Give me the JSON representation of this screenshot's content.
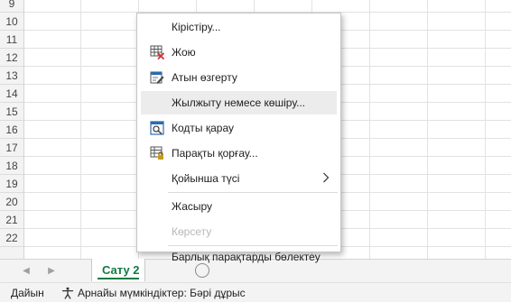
{
  "grid": {
    "row_numbers": [
      "9",
      "10",
      "11",
      "12",
      "13",
      "14",
      "15",
      "16",
      "17",
      "18",
      "19",
      "20",
      "21",
      "22"
    ]
  },
  "context_menu": {
    "items": [
      {
        "label": "Кірістіру...",
        "icon": "none"
      },
      {
        "label": "Жою",
        "icon": "delete-sheet-icon"
      },
      {
        "label": "Атын өзгерту",
        "icon": "rename-sheet-icon"
      },
      {
        "label": "Жылжыту немесе көшіру...",
        "icon": "none",
        "highlighted": true
      },
      {
        "label": "Кодты қарау",
        "icon": "view-code-icon"
      },
      {
        "label": "Парақты қорғау...",
        "icon": "protect-sheet-icon"
      },
      {
        "label": "Қойынша түсі",
        "icon": "chevron-right-icon",
        "submenu": true
      },
      {
        "label": "Жасыру",
        "icon": "none"
      },
      {
        "label": "Көрсету",
        "icon": "none",
        "disabled": true
      },
      {
        "label": "Барлық парақтарды бөлектеу",
        "icon": "none"
      }
    ]
  },
  "sheet_tabs": {
    "active_tab": "Сату 2"
  },
  "status_bar": {
    "ready": "Дайын",
    "accessibility": "Арнайы мүмкіндіктер: Бәрі дұрыс"
  },
  "colors": {
    "excel_green": "#107c41",
    "delete_red": "#d13438",
    "info_blue": "#2b6cb0",
    "lock_gold": "#c59a17"
  }
}
